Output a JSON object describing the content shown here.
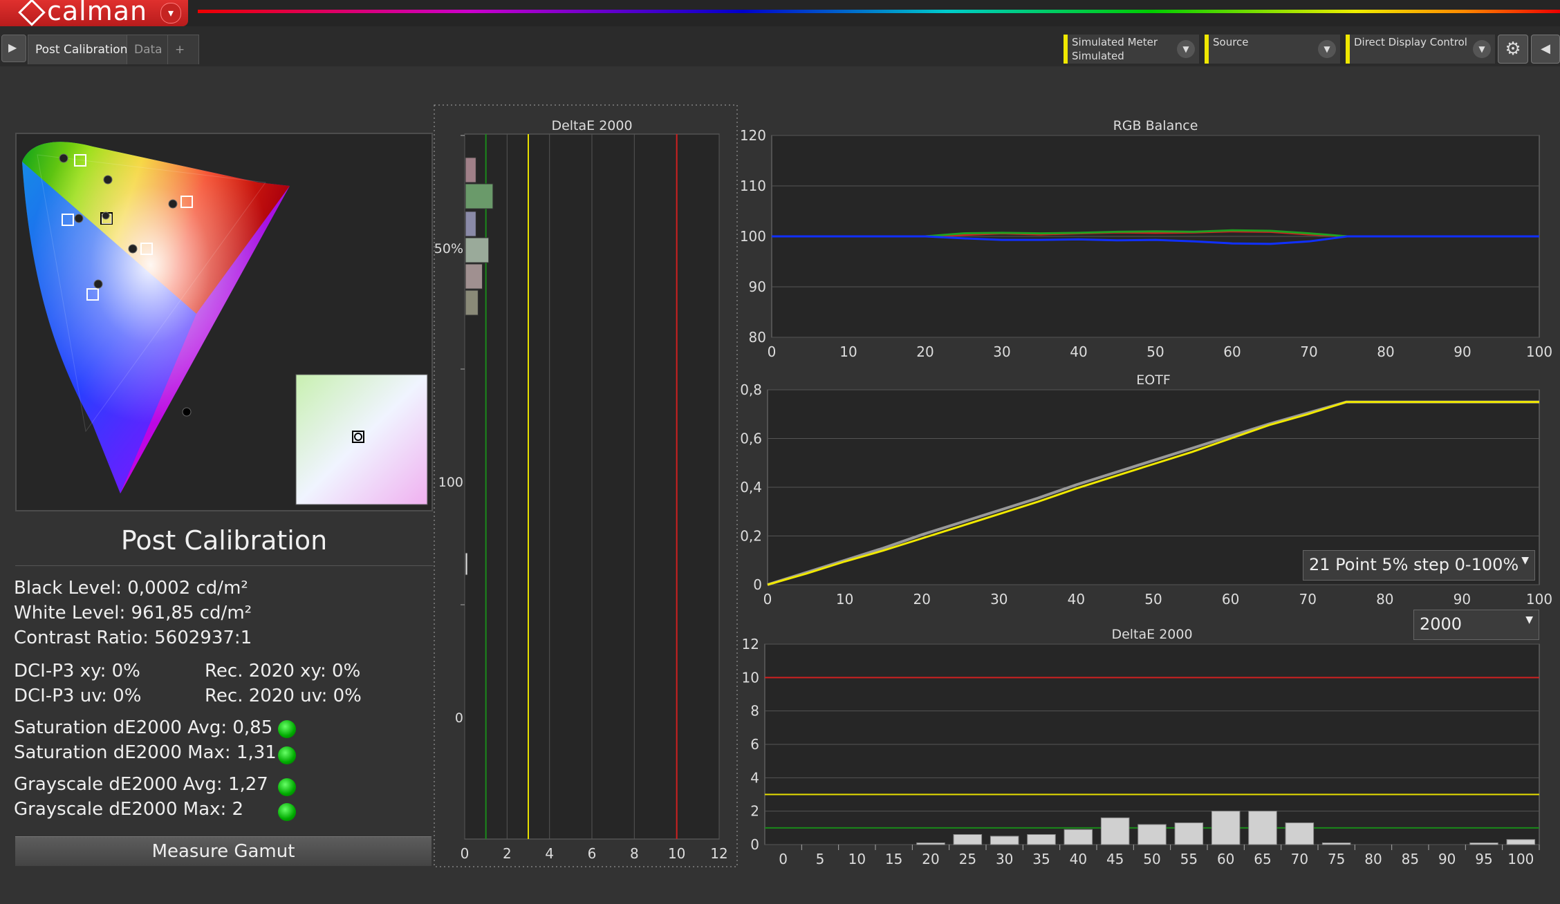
{
  "app": {
    "logo_text": "calman",
    "logo_drop": "▾"
  },
  "tabs": [
    {
      "label": "Post Calibration"
    },
    {
      "label": "Data"
    },
    {
      "label": "+"
    }
  ],
  "toolbar": {
    "meter": {
      "line1": "Simulated Meter",
      "line2": "Simulated"
    },
    "source": {
      "line1": "Source",
      "line2": ""
    },
    "display": {
      "line1": "Direct Display Control",
      "line2": ""
    },
    "dropdown_arrow": "▼",
    "gear_icon": "⚙",
    "nav_icon": "◀",
    "play_icon": "▶"
  },
  "summary": {
    "title": "Post Calibration",
    "black_level": "Black Level: 0,0002 cd/m²",
    "white_level": "White Level: 961,85 cd/m²",
    "contrast": "Contrast Ratio: 5602937:1",
    "dcip3_xy": "DCI-P3 xy: 0%",
    "rec2020_xy": "Rec. 2020 xy: 0%",
    "dcip3_uv": "DCI-P3 uv: 0%",
    "rec2020_uv": "Rec. 2020 uv: 0%",
    "sat_avg": "Saturation dE2000 Avg: 0,85",
    "sat_max": "Saturation dE2000 Max: 1,31",
    "gray_avg": "Grayscale dE2000 Avg: 1,27",
    "gray_max": "Grayscale dE2000 Max: 2",
    "measure_button": "Measure Gamut"
  },
  "colors": {
    "accent_yellow": "#f0e800",
    "threshold_red": "#e02020",
    "threshold_green": "#1a8a1a",
    "ok_green": "#22cc22"
  },
  "combos": {
    "points": "21 Point 5% step 0-100%",
    "nits": "2000"
  },
  "chart_data": [
    {
      "type": "bar",
      "title": "DeltaE 2000",
      "orientation": "horizontal",
      "xlabel": "",
      "xlim": [
        0,
        12
      ],
      "xticks": [
        "0",
        "2",
        "4",
        "6",
        "8",
        "10",
        "12"
      ],
      "ytick_labels": [
        "50%",
        "100",
        "0"
      ],
      "threshold_lines": [
        {
          "value": 1,
          "color": "green"
        },
        {
          "value": 3,
          "color": "yellow"
        },
        {
          "value": 10,
          "color": "red"
        }
      ],
      "values": [
        0.5,
        1.3,
        0.5,
        1.1,
        0.8,
        0.6,
        0.1
      ]
    },
    {
      "type": "line",
      "title": "RGB Balance",
      "xlim": [
        0,
        100
      ],
      "ylim": [
        80,
        120
      ],
      "xticks": [
        "0",
        "10",
        "20",
        "30",
        "40",
        "50",
        "60",
        "70",
        "80",
        "90",
        "100"
      ],
      "yticks": [
        "80",
        "90",
        "100",
        "110",
        "120"
      ],
      "x": [
        0,
        5,
        10,
        15,
        20,
        25,
        30,
        35,
        40,
        45,
        50,
        55,
        60,
        65,
        70,
        75,
        80,
        85,
        90,
        95,
        100
      ],
      "series": [
        {
          "color": "red",
          "values": [
            100,
            100,
            100,
            100,
            100,
            100.3,
            100.6,
            100.4,
            100.6,
            100.8,
            100.7,
            100.8,
            101,
            100.9,
            100.4,
            100,
            100,
            100,
            100,
            100,
            100
          ]
        },
        {
          "color": "green",
          "values": [
            100,
            100,
            100,
            100,
            100,
            100.6,
            100.7,
            100.6,
            100.7,
            100.9,
            101,
            100.9,
            101.2,
            101.1,
            100.6,
            100,
            100,
            100,
            100,
            100,
            100
          ]
        },
        {
          "color": "blue",
          "values": [
            100,
            100,
            100,
            100,
            100,
            99.6,
            99.3,
            99.3,
            99.4,
            99.2,
            99.3,
            99,
            98.6,
            98.5,
            99,
            100,
            100,
            100,
            100,
            100,
            100
          ]
        }
      ]
    },
    {
      "type": "line",
      "title": "EOTF",
      "xlim": [
        0,
        100
      ],
      "ylim": [
        0,
        0.8
      ],
      "xticks": [
        "0",
        "10",
        "20",
        "30",
        "40",
        "50",
        "60",
        "70",
        "80",
        "90",
        "100"
      ],
      "yticks": [
        "0",
        "0,2",
        "0,4",
        "0,6",
        "0,8"
      ],
      "x": [
        0,
        5,
        10,
        15,
        20,
        25,
        30,
        35,
        40,
        45,
        50,
        55,
        60,
        65,
        70,
        75,
        80,
        85,
        90,
        95,
        100
      ],
      "series": [
        {
          "color": "gray",
          "values": [
            0,
            0.05,
            0.1,
            0.15,
            0.205,
            0.255,
            0.305,
            0.355,
            0.41,
            0.46,
            0.51,
            0.56,
            0.61,
            0.66,
            0.705,
            0.75,
            0.75,
            0.75,
            0.75,
            0.75,
            0.75
          ]
        },
        {
          "color": "yellow",
          "values": [
            0,
            0.045,
            0.095,
            0.14,
            0.19,
            0.24,
            0.29,
            0.34,
            0.395,
            0.445,
            0.495,
            0.545,
            0.6,
            0.655,
            0.7,
            0.75,
            0.75,
            0.75,
            0.75,
            0.75,
            0.75
          ]
        }
      ]
    },
    {
      "type": "bar",
      "title": "DeltaE 2000",
      "ylim": [
        0,
        12
      ],
      "yticks": [
        "0",
        "2",
        "4",
        "6",
        "8",
        "10",
        "12"
      ],
      "categories": [
        "0",
        "5",
        "10",
        "15",
        "20",
        "25",
        "30",
        "35",
        "40",
        "45",
        "50",
        "55",
        "60",
        "65",
        "70",
        "75",
        "80",
        "85",
        "90",
        "95",
        "100"
      ],
      "values": [
        0,
        0,
        0,
        0,
        0.1,
        0.6,
        0.5,
        0.6,
        0.9,
        1.6,
        1.2,
        1.3,
        2.0,
        2.0,
        1.3,
        0.1,
        0,
        0,
        0,
        0.1,
        0.3
      ],
      "threshold_lines": [
        {
          "value": 1,
          "color": "green"
        },
        {
          "value": 3,
          "color": "yellow"
        },
        {
          "value": 10,
          "color": "red"
        }
      ]
    }
  ]
}
